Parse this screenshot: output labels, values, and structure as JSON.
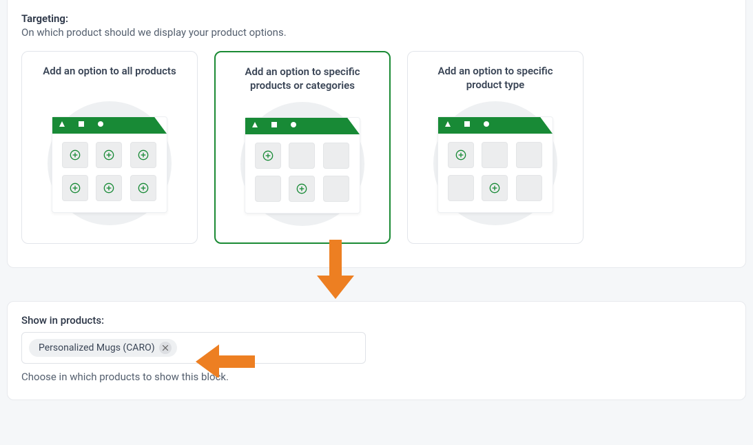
{
  "targeting": {
    "heading": "Targeting:",
    "subheading": "On which product should we display your product options.",
    "cards": [
      {
        "title": "Add an option to all products",
        "selected": false,
        "plus_pattern": [
          true,
          true,
          true,
          true,
          true,
          true
        ]
      },
      {
        "title": "Add an option to specific products or categories",
        "selected": true,
        "plus_pattern": [
          true,
          false,
          false,
          false,
          true,
          false
        ]
      },
      {
        "title": "Add an option to specific product type",
        "selected": false,
        "plus_pattern": [
          true,
          false,
          false,
          false,
          true,
          false
        ]
      }
    ]
  },
  "show_in_products": {
    "heading": "Show in products:",
    "tags": [
      {
        "label": "Personalized Mugs (CARO)"
      }
    ],
    "helper": "Choose in which products to show this block."
  },
  "colors": {
    "accent_green": "#188a36",
    "arrow_orange": "#ed7f22"
  }
}
